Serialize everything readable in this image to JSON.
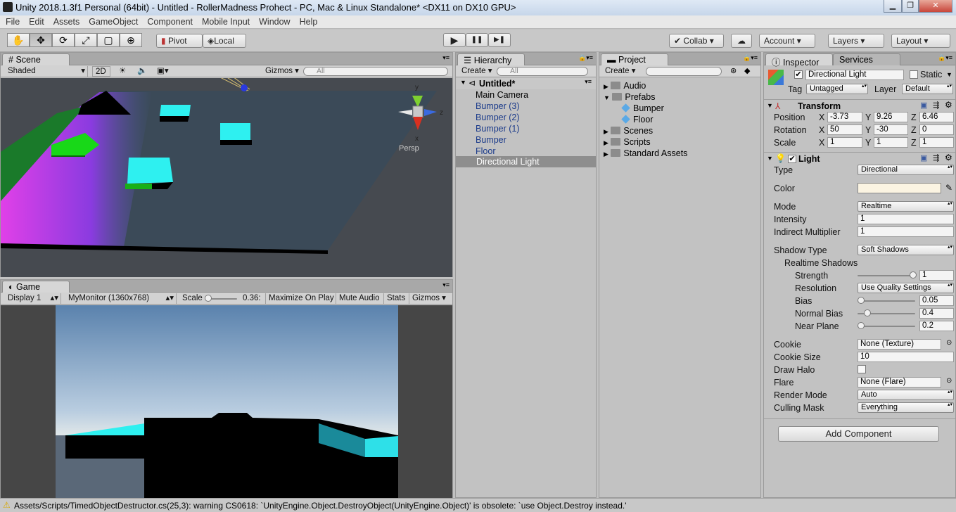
{
  "window": {
    "title": "Unity 2018.1.3f1 Personal (64bit) - Untitled - RollerMadness Prohect - PC, Mac & Linux Standalone* <DX11 on DX10 GPU>",
    "min": "▁",
    "max": "❐",
    "close": "✕"
  },
  "menu": [
    "File",
    "Edit",
    "Assets",
    "GameObject",
    "Component",
    "Mobile Input",
    "Window",
    "Help"
  ],
  "toolbar": {
    "tools": [
      "✋",
      "✥",
      "⟳",
      "⤢",
      "▢",
      "⊕"
    ],
    "pivot": "Pivot",
    "local": "Local",
    "play": "▶",
    "pause": "❚❚",
    "step": "▶❚",
    "collab": "Collab ▾",
    "cloud": "☁",
    "account": "Account",
    "layers": "Layers",
    "layout": "Layout"
  },
  "scene": {
    "tab": "Scene",
    "shading": "Shaded",
    "mode2d": "2D",
    "gizmos": "Gizmos",
    "search": "All",
    "persp": "Persp",
    "axis_y": "y",
    "axis_z": "z",
    "axis_x": "x"
  },
  "game": {
    "tab": "Game",
    "display": "Display 1",
    "resolution": "MyMonitor (1360x768)",
    "scale_label": "Scale",
    "scale_value": "0.36:",
    "maximize": "Maximize On Play",
    "mute": "Mute Audio",
    "stats": "Stats",
    "gizmos": "Gizmos"
  },
  "hierarchy": {
    "tab": "Hierarchy",
    "create": "Create",
    "search": "All",
    "scene": "Untitled*",
    "items": [
      "Main Camera",
      "Bumper (3)",
      "Bumper (2)",
      "Bumper (1)",
      "Bumper",
      "Floor",
      "Directional Light"
    ]
  },
  "project": {
    "tab": "Project",
    "create": "Create",
    "folders": [
      "Audio",
      "Prefabs",
      "Bumper",
      "Floor",
      "Scenes",
      "Scripts",
      "Standard Assets"
    ]
  },
  "inspector": {
    "tab": "Inspector",
    "services": "Services",
    "object_name": "Directional Light",
    "static": "Static",
    "tag_label": "Tag",
    "tag": "Untagged",
    "layer_label": "Layer",
    "layer": "Default",
    "transform": {
      "title": "Transform",
      "position": "Position",
      "rotation": "Rotation",
      "scale": "Scale",
      "pos": [
        "-3.73",
        "9.26",
        "6.46"
      ],
      "rot": [
        "50",
        "-30",
        "0"
      ],
      "scl": [
        "1",
        "1",
        "1"
      ],
      "x": "X",
      "y": "Y",
      "z": "Z"
    },
    "light": {
      "title": "Light",
      "type_label": "Type",
      "type": "Directional",
      "color_label": "Color",
      "color": "#fbf4e2",
      "mode_label": "Mode",
      "mode": "Realtime",
      "intensity_label": "Intensity",
      "intensity": "1",
      "indirect_label": "Indirect Multiplier",
      "indirect": "1",
      "shadow_label": "Shadow Type",
      "shadow": "Soft Shadows",
      "realtime": "Realtime Shadows",
      "strength_label": "Strength",
      "strength": "1",
      "resolution_label": "Resolution",
      "resolution": "Use Quality Settings",
      "bias_label": "Bias",
      "bias": "0.05",
      "nbias_label": "Normal Bias",
      "nbias": "0.4",
      "near_label": "Near Plane",
      "near": "0.2",
      "cookie_label": "Cookie",
      "cookie": "None (Texture)",
      "cookiesize_label": "Cookie Size",
      "cookiesize": "10",
      "halo_label": "Draw Halo",
      "flare_label": "Flare",
      "flare": "None (Flare)",
      "render_label": "Render Mode",
      "render": "Auto",
      "culling_label": "Culling Mask",
      "culling": "Everything"
    },
    "add_component": "Add Component"
  },
  "status": "Assets/Scripts/TimedObjectDestructor.cs(25,3): warning CS0618: `UnityEngine.Object.DestroyObject(UnityEngine.Object)' is obsolete: `use Object.Destroy instead.'"
}
